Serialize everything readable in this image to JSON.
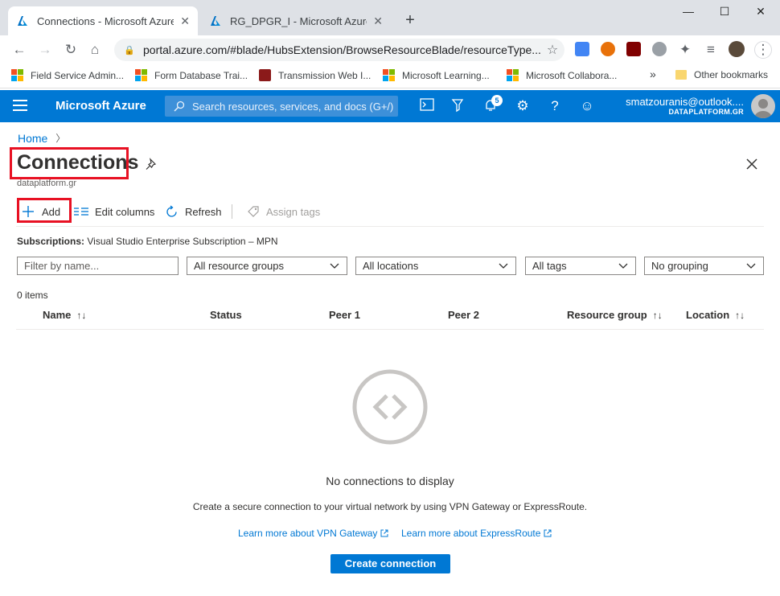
{
  "browser": {
    "tabs": [
      {
        "title": "Connections - Microsoft Azure",
        "active": true
      },
      {
        "title": "RG_DPGR_I - Microsoft Azure",
        "active": false
      }
    ],
    "new_tab": "+",
    "window_controls": {
      "minimize": "—",
      "maximize": "☐",
      "close": "✕"
    },
    "url": "portal.azure.com/#blade/HubsExtension/BrowseResourceBlade/resourceType...",
    "bookmarks": [
      {
        "label": "Field Service Admin...",
        "icon": "microsoft-logo-icon"
      },
      {
        "label": "Form Database Trai...",
        "icon": "microsoft-logo-icon"
      },
      {
        "label": "Transmission Web I...",
        "icon": "transmission-icon"
      },
      {
        "label": "Microsoft Learning...",
        "icon": "microsoft-logo-icon"
      },
      {
        "label": "Microsoft Collabora...",
        "icon": "microsoft-logo-icon"
      }
    ],
    "bookmarks_overflow": "»",
    "other_bookmarks": "Other bookmarks"
  },
  "azure": {
    "brand": "Microsoft Azure",
    "search_placeholder": "Search resources, services, and docs (G+/)",
    "notification_count": "5",
    "account_email": "smatzouranis@outlook....",
    "account_org": "DATAPLATFORM.GR",
    "accent": "#0078d4"
  },
  "blade": {
    "breadcrumb_home": "Home",
    "title": "Connections",
    "subtitle": "dataplatform.gr",
    "toolbar": {
      "add": "Add",
      "edit_columns": "Edit columns",
      "refresh": "Refresh",
      "assign_tags": "Assign tags"
    },
    "subscriptions_label": "Subscriptions:",
    "subscriptions_value": "Visual Studio Enterprise Subscription – MPN",
    "filters": {
      "name_placeholder": "Filter by name...",
      "resource_groups": "All resource groups",
      "locations": "All locations",
      "tags": "All tags",
      "grouping": "No grouping"
    },
    "count": "0 items",
    "columns": [
      "Name",
      "Status",
      "Peer 1",
      "Peer 2",
      "Resource group",
      "Location"
    ],
    "sort_glyph": "↑↓",
    "empty": {
      "title": "No connections to display",
      "description": "Create a secure connection to your virtual network by using VPN Gateway or ExpressRoute.",
      "link_vpn": "Learn more about VPN Gateway",
      "link_expressroute": "Learn more about ExpressRoute",
      "create_button": "Create connection"
    }
  }
}
